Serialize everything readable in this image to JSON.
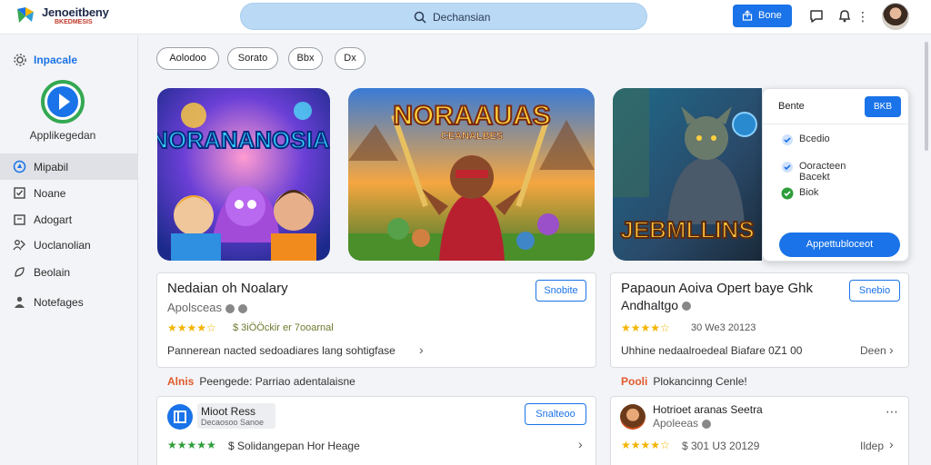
{
  "app": {
    "title": "Jenoeitbeny",
    "subtitle": "BKEDMESIS"
  },
  "search": {
    "text": "Dechansian"
  },
  "header": {
    "share_label": "Bone"
  },
  "sidebar": {
    "heading": "Inpacale",
    "app_name": "Applikegedan",
    "items": [
      {
        "label": "Mipabil",
        "icon": "grid-icon",
        "active": true
      },
      {
        "label": "Noane",
        "icon": "checkbox-icon",
        "active": false
      },
      {
        "label": "Adogart",
        "icon": "folder-icon",
        "active": false
      },
      {
        "label": "Uoclanolian",
        "icon": "users-icon",
        "active": false
      },
      {
        "label": "Beolain",
        "icon": "leaf-icon",
        "active": false
      },
      {
        "label": "Notefages",
        "icon": "person-icon",
        "active": false
      }
    ]
  },
  "filters": [
    "Aolodoo",
    "Sorato",
    "Bbx",
    "Dx"
  ],
  "banners": [
    {
      "title": "NORANANOSIAI"
    },
    {
      "title": "NORAAUAS",
      "subtitle": "CEANALBES"
    },
    {
      "title": "JEBMLLINS"
    }
  ],
  "popup": {
    "title": "Bente",
    "small_button": "BKB",
    "options": [
      {
        "label": "Bcedio",
        "icon": "blue-check-icon"
      },
      {
        "label": "Ooracteen Bacekt",
        "icon": "blue-check-icon"
      },
      {
        "label": "Biok",
        "icon": "green-check-icon"
      }
    ],
    "wide_button": "Appettubloceot"
  },
  "cards": [
    {
      "title": "Nedaian oh Noalary",
      "subtitle": "Apolsceas",
      "button": "Snobite",
      "rating_stars": "★★★★☆",
      "meta": "$ 3iÖÖckir er 7ooarnal",
      "description": "Pannerean nacted sedoadiares lang sohtigfase"
    },
    {
      "title": "Papaoun Aoiva Opert baye Ghk",
      "title2": "Andhaltgo",
      "button": "Snebio",
      "rating_stars": "★★★★☆",
      "meta": "30 We3 20123",
      "description": "Uhhine nedaalroedeal Biafare 0Z1 00",
      "side_text": "Deen"
    }
  ],
  "sections": [
    {
      "accent": "Alnis",
      "label": "Peengede: Parriao adentalaisne"
    },
    {
      "accent": "Pooli",
      "label": "Plokancinng Cenle!"
    }
  ],
  "bottom_cards": [
    {
      "name": "Mioot Ress",
      "sub": "Decaosoo Sanoe",
      "button": "Snalteoo",
      "rating_stars": "★★★★★",
      "meta": "$ Solidangepan Hor Heage"
    },
    {
      "name": "Hotrioet aranas Seetra",
      "sub": "Apoleeas",
      "rating_stars": "★★★★☆",
      "meta": "$ 301 U3 20129",
      "side_text": "Ildep"
    }
  ],
  "colors": {
    "accent": "#1a73e8",
    "search_bg": "#b9d9f5",
    "star": "#f4b400"
  }
}
